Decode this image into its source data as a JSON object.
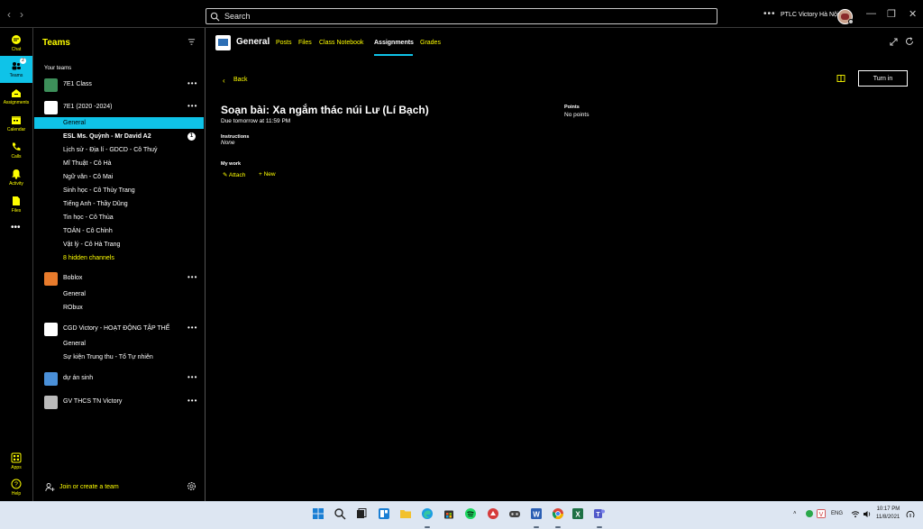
{
  "titlebar": {
    "back_arrow": "‹",
    "forward_arrow": "›",
    "search_placeholder": "Search",
    "more": "•••",
    "org_name": "PTLC Victory Hà Nội",
    "minimize": "—",
    "restore": "❐",
    "close": "✕"
  },
  "rail": {
    "items": [
      {
        "label": "Chat",
        "icon": "chat-icon"
      },
      {
        "label": "Teams",
        "icon": "teams-icon",
        "badge": "2"
      },
      {
        "label": "Assignments",
        "icon": "assignments-icon"
      },
      {
        "label": "Calendar",
        "icon": "calendar-icon"
      },
      {
        "label": "Calls",
        "icon": "calls-icon"
      },
      {
        "label": "Activity",
        "icon": "bell-icon"
      },
      {
        "label": "Files",
        "icon": "files-icon"
      },
      {
        "label": "Apps",
        "icon": "apps-icon"
      },
      {
        "label": "Help",
        "icon": "help-icon"
      }
    ],
    "more": "•••"
  },
  "teams_panel": {
    "title": "Teams",
    "your_teams": "Your teams",
    "teams": [
      {
        "name": "7E1 Class",
        "more": "•••",
        "logo_color": "#3d8f5a",
        "channels": []
      },
      {
        "name": "7E1 (2020 -2024)",
        "more": "•••",
        "logo_color": "#ffffff",
        "channels": [
          "General",
          "ESL Ms. Quỳnh - Mr David A2",
          "Lịch sử - Địa lí - GDCD - Cô Thuỷ",
          "Mĩ Thuật - Cô Hà",
          "Ngữ văn - Cô Mai",
          "Sinh học - Cô Thùy Trang",
          "Tiếng Anh - Thầy Dũng",
          "Tin học - Cô Thùa",
          "TOÁN - Cô Chỉnh",
          "Vật lý - Cô Hà Trang",
          "8 hidden channels"
        ]
      },
      {
        "name": "Boblox",
        "more": "•••",
        "logo_color": "#e87b2c",
        "channels": [
          "General",
          "RObux"
        ]
      },
      {
        "name": "CGD Victory - HOẠT ĐỘNG TẬP THỂ",
        "more": "•••",
        "logo_color": "#ffffff",
        "channels": [
          "General",
          "Sự kiện Trung thu - Tổ Tự nhiên"
        ]
      },
      {
        "name": "dự án sinh",
        "more": "•••",
        "logo_color": "#4a90d9",
        "channels": []
      },
      {
        "name": "GV THCS TN Victory",
        "more": "•••",
        "logo_color": "#bbbbbb",
        "channels": []
      }
    ],
    "unread_count": "1",
    "join_label": "Join or create a team"
  },
  "main": {
    "channel_title": "General",
    "tabs": [
      "Posts",
      "Files",
      "Class Notebook",
      "Assignments",
      "Grades"
    ],
    "active_tab": "Assignments",
    "back_label": "Back",
    "turn_in_label": "Turn in",
    "assignment": {
      "title": "Soạn bài: Xa ngắm thác núi Lư (Lí Bạch)",
      "due": "Due tomorrow at 11:59 PM",
      "points_label": "Points",
      "points_value": "No points",
      "instructions_label": "Instructions",
      "instructions_value": "None",
      "my_work_label": "My work",
      "attach_label": "Attach",
      "new_label": "New"
    }
  },
  "taskbar": {
    "lang": "ENG",
    "time": "10:17 PM",
    "date": "11/8/2021"
  },
  "colors": {
    "accent": "#0fc3e8",
    "link": "#ffff00"
  }
}
